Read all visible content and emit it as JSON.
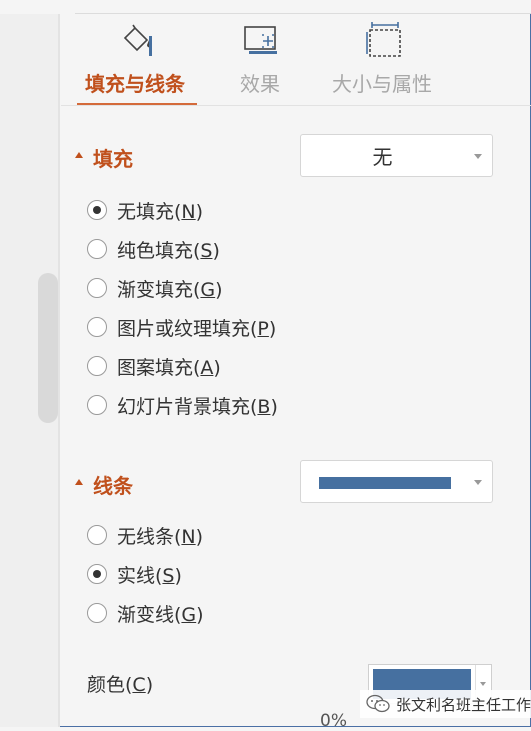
{
  "tabs": [
    {
      "label": "填充与线条",
      "icon": "fill-line-icon",
      "active": true
    },
    {
      "label": "效果",
      "icon": "effects-icon",
      "active": false
    },
    {
      "label": "大小与属性",
      "icon": "size-properties-icon",
      "active": false
    }
  ],
  "fill": {
    "title": "填充",
    "dropdown_value": "无",
    "options": [
      {
        "text": "无填充(",
        "key": "N",
        "tail": ")",
        "checked": true
      },
      {
        "text": "纯色填充(",
        "key": "S",
        "tail": ")",
        "checked": false
      },
      {
        "text": "渐变填充(",
        "key": "G",
        "tail": ")",
        "checked": false
      },
      {
        "text": "图片或纹理填充(",
        "key": "P",
        "tail": ")",
        "checked": false
      },
      {
        "text": "图案填充(",
        "key": "A",
        "tail": ")",
        "checked": false
      },
      {
        "text": "幻灯片背景填充(",
        "key": "B",
        "tail": ")",
        "checked": false
      }
    ]
  },
  "line": {
    "title": "线条",
    "swatch_color": "#4670a0",
    "options": [
      {
        "text": "无线条(",
        "key": "N",
        "tail": ")",
        "checked": false
      },
      {
        "text": "实线(",
        "key": "S",
        "tail": ")",
        "checked": true
      },
      {
        "text": "渐变线(",
        "key": "G",
        "tail": ")",
        "checked": false
      }
    ],
    "color_label": "颜色(",
    "color_key": "C",
    "color_tail": ")",
    "color_value": "#4670a0",
    "partial_text": "0%"
  },
  "watermark": {
    "text": "张文利名班主任工作室",
    "icon": "wechat-icon"
  },
  "colors": {
    "accent": "#c0501c",
    "line_blue": "#4670a0"
  }
}
